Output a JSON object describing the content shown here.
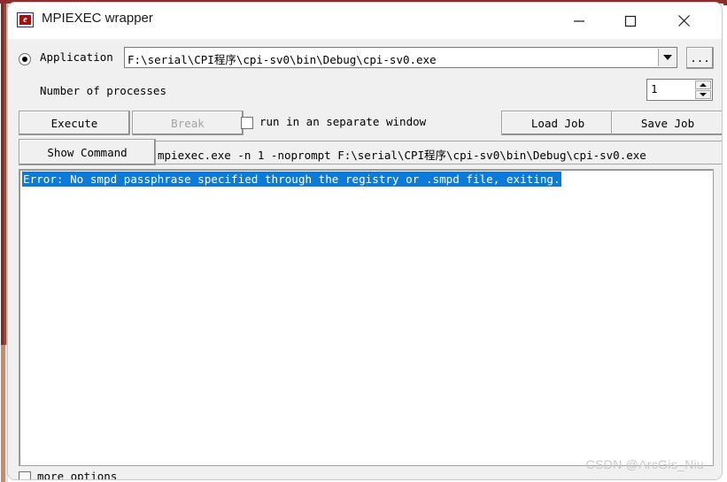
{
  "window": {
    "title": "MPIEXEC wrapper",
    "icon": "mpiexec-app-icon",
    "icon_glyph": "e",
    "controls": {
      "minimize": "—",
      "maximize": "☐",
      "close": "✕"
    }
  },
  "form": {
    "application": {
      "radio_selected": true,
      "label": "Application",
      "value": "F:\\serial\\CPI程序\\cpi-sv0\\bin\\Debug\\cpi-sv0.exe",
      "browse_label": "..."
    },
    "processes": {
      "label": "Number of processes",
      "value": "1"
    },
    "buttons": {
      "execute": "Execute",
      "break": "Break",
      "break_disabled": true,
      "load_job": "Load Job",
      "save_job": "Save Job",
      "show_command": "Show Command"
    },
    "separate_window": {
      "label": "run in an separate window",
      "checked": false
    },
    "command": {
      "value": "mpiexec.exe -n 1  -noprompt F:\\serial\\CPI程序\\cpi-sv0\\bin\\Debug\\cpi-sv0.exe"
    },
    "more_options": {
      "label": "more options",
      "checked": false
    }
  },
  "output": {
    "lines": [
      "Error: No smpd passphrase specified through the registry or .smpd file, exiting."
    ],
    "selection_color": "#0c7ad6",
    "selection_text_color": "#ffffff"
  },
  "watermark": {
    "text": "CSDN @ArcGis_Niu"
  },
  "colors": {
    "window_background": "#f0f0f0",
    "titlebar_background": "#ffffff",
    "field_background": "#ffffff",
    "desktop_accent": "#8d2d2d",
    "disabled_text": "#a3a3a3"
  }
}
